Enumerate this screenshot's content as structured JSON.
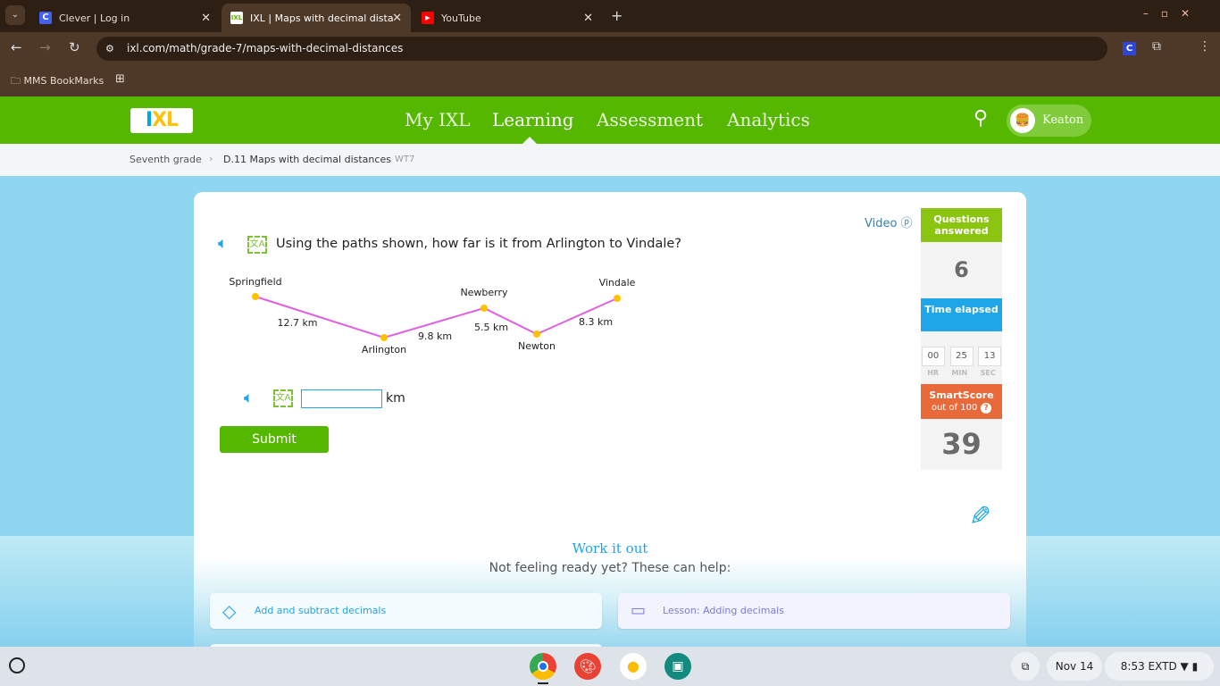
{
  "browser": {
    "tabs": [
      {
        "title": "Clever | Log in",
        "icon": "clever-icon"
      },
      {
        "title": "IXL | Maps with decimal distanc",
        "icon": "ixl-icon",
        "active": true
      },
      {
        "title": "YouTube",
        "icon": "youtube-icon"
      }
    ],
    "url": "ixl.com/math/grade-7/maps-with-decimal-distances",
    "bookmarks": [
      {
        "label": "MMS BookMarks"
      }
    ]
  },
  "header": {
    "logo": "IXL",
    "nav": [
      "My IXL",
      "Learning",
      "Assessment",
      "Analytics"
    ],
    "selected_nav": "Learning",
    "user": "Keaton",
    "brand_color": "#56b700"
  },
  "breadcrumb": {
    "grade": "Seventh grade",
    "skill": "D.11 Maps with decimal distances",
    "code": "WT7"
  },
  "question": {
    "video_label": "Video",
    "text": "Using the paths shown, how far is it from Arlington to Vindale?",
    "map": {
      "cities": [
        "Springfield",
        "Arlington",
        "Newberry",
        "Newton",
        "Vindale"
      ],
      "paths": [
        {
          "from": "Springfield",
          "to": "Arlington",
          "label": "12.7 km"
        },
        {
          "from": "Arlington",
          "to": "Newberry",
          "label": "9.8 km"
        },
        {
          "from": "Newberry",
          "to": "Newton",
          "label": "5.5 km"
        },
        {
          "from": "Newton",
          "to": "Vindale",
          "label": "8.3 km"
        }
      ]
    },
    "answer_value": "",
    "unit": "km",
    "submit_label": "Submit"
  },
  "stats": {
    "questions_label": "Questions answered",
    "questions": "6",
    "time_label": "Time elapsed",
    "hr": "00",
    "min": "25",
    "sec": "13",
    "hr_label": "HR",
    "min_label": "MIN",
    "sec_label": "SEC",
    "smartscore_label": "SmartScore",
    "smartscore_sub": "out of 100",
    "smartscore": "39"
  },
  "help": {
    "title": "Work it out",
    "subtitle": "Not feeling ready yet? These can help:",
    "items": [
      {
        "label": "Add and subtract decimals"
      },
      {
        "label": "Lesson: Adding decimals"
      }
    ]
  },
  "taskbar": {
    "date": "Nov 14",
    "time": "8:53",
    "extra": "EXTD"
  }
}
